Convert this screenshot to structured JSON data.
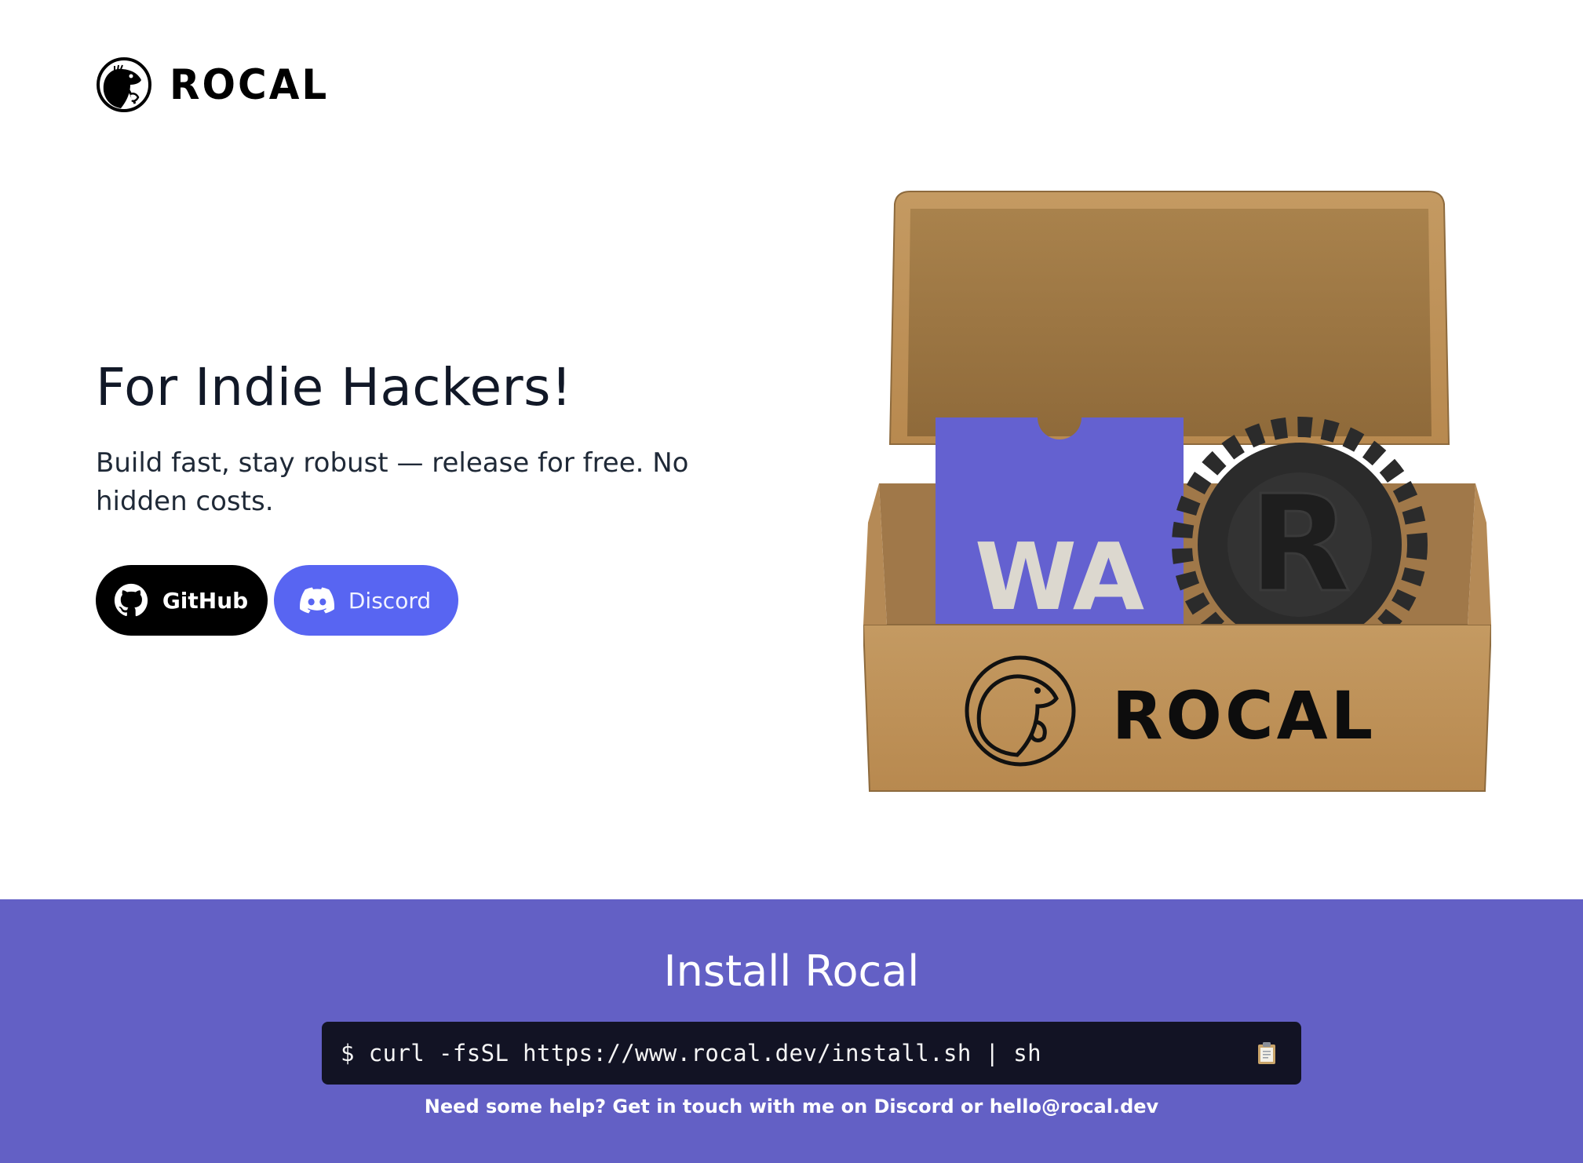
{
  "brand": {
    "name": "ROCAL"
  },
  "hero": {
    "title": "For Indie Hackers!",
    "subtitle": "Build fast, stay robust — release for free. No hidden costs.",
    "github_label": "GitHub",
    "discord_label": "Discord",
    "image_box_text": "ROCAL",
    "image_card_text": "WA",
    "image_gear_text": "R"
  },
  "install": {
    "title": "Install Rocal",
    "command": "$ curl -fsSL https://www.rocal.dev/install.sh | sh",
    "help": "Need some help? Get in touch with me on Discord or hello@rocal.dev"
  },
  "colors": {
    "github_bg": "#000000",
    "discord_bg": "#5865f2",
    "install_bg": "#6360c5",
    "terminal_bg": "#121324",
    "card_purple": "#6461d0"
  },
  "icons": [
    "rocal-mole-logo",
    "github-icon",
    "discord-icon",
    "clipboard-icon"
  ]
}
